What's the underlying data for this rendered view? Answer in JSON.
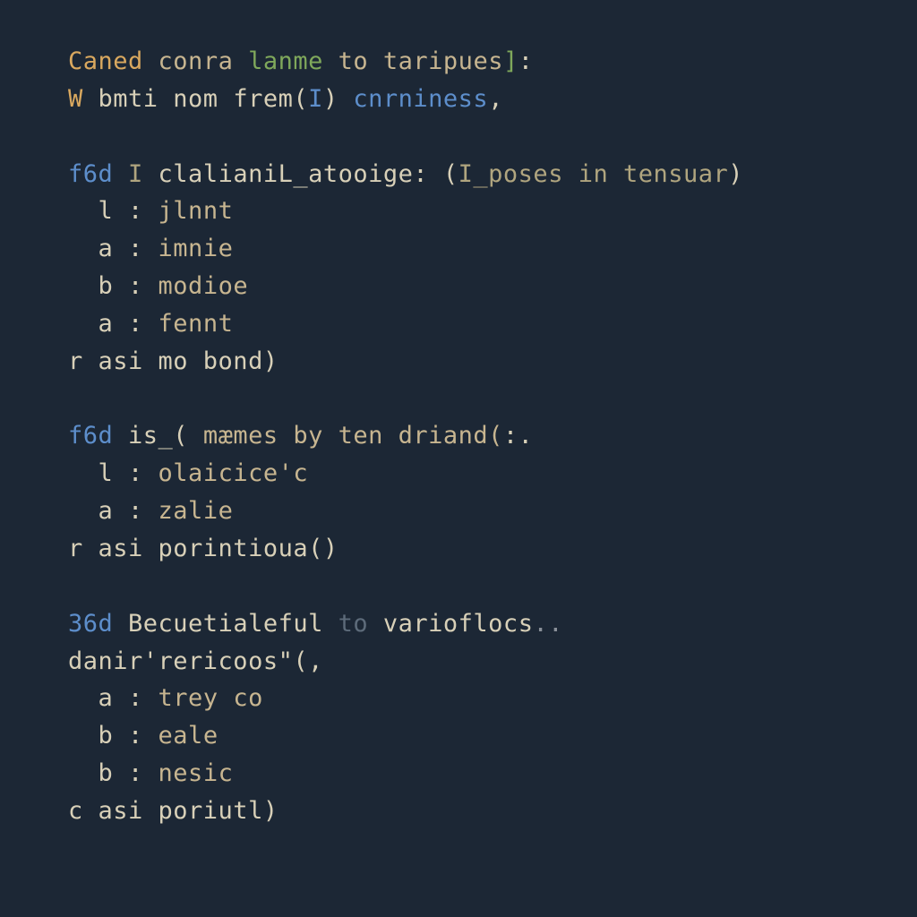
{
  "colors": {
    "bg": "#1c2735",
    "orange": "#d9a85f",
    "green": "#7fa85b",
    "blue": "#5d8ecb",
    "cream": "#d8d0b8",
    "gray": "#8a9099",
    "tan": "#c7b590",
    "grayblue": "#5d6b7a",
    "tan2": "#b0a57f"
  },
  "lines": [
    {
      "id": "l01",
      "tokens": [
        {
          "cls": "c-orange",
          "text": "Caned "
        },
        {
          "cls": "c-tan",
          "text": "conra "
        },
        {
          "cls": "c-green",
          "text": "lanme "
        },
        {
          "cls": "c-tan",
          "text": "to taripues"
        },
        {
          "cls": "c-green",
          "text": "]"
        },
        {
          "cls": "c-cream",
          "text": ":"
        }
      ]
    },
    {
      "id": "l02",
      "tokens": [
        {
          "cls": "c-orange",
          "text": "W "
        },
        {
          "cls": "c-cream",
          "text": "bmti nom frem("
        },
        {
          "cls": "c-blue",
          "text": "I"
        },
        {
          "cls": "c-cream",
          "text": ") "
        },
        {
          "cls": "c-blue",
          "text": "cnrniness"
        },
        {
          "cls": "c-cream",
          "text": ","
        }
      ]
    },
    {
      "id": "l03",
      "blank": true
    },
    {
      "id": "l04",
      "tokens": [
        {
          "cls": "c-bluekey",
          "text": "f6d "
        },
        {
          "cls": "c-tan2",
          "text": "I "
        },
        {
          "cls": "c-cream",
          "text": "clalianiL_atooige: ("
        },
        {
          "cls": "c-tan2",
          "text": "I_poses in tensuar"
        },
        {
          "cls": "c-cream",
          "text": ")"
        }
      ]
    },
    {
      "id": "l05",
      "tokens": [
        {
          "cls": "c-cream",
          "text": "  l : "
        },
        {
          "cls": "c-tan",
          "text": "jlnnt"
        }
      ]
    },
    {
      "id": "l06",
      "tokens": [
        {
          "cls": "c-cream",
          "text": "  a : "
        },
        {
          "cls": "c-tan",
          "text": "imnie"
        }
      ]
    },
    {
      "id": "l07",
      "tokens": [
        {
          "cls": "c-cream",
          "text": "  b : "
        },
        {
          "cls": "c-tan",
          "text": "modioe"
        }
      ]
    },
    {
      "id": "l08",
      "tokens": [
        {
          "cls": "c-cream",
          "text": "  a : "
        },
        {
          "cls": "c-tan",
          "text": "fennt"
        }
      ]
    },
    {
      "id": "l09",
      "tokens": [
        {
          "cls": "c-cream",
          "text": "r asi mo bond)"
        }
      ]
    },
    {
      "id": "l10",
      "blank": true
    },
    {
      "id": "l11",
      "tokens": [
        {
          "cls": "c-bluekey",
          "text": "f6d "
        },
        {
          "cls": "c-cream",
          "text": "is_( "
        },
        {
          "cls": "c-tan",
          "text": "mæmes by ten driand("
        },
        {
          "cls": "c-cream",
          "text": ":."
        }
      ]
    },
    {
      "id": "l12",
      "tokens": [
        {
          "cls": "c-cream",
          "text": "  l : "
        },
        {
          "cls": "c-tan",
          "text": "olaicice'c"
        }
      ]
    },
    {
      "id": "l13",
      "tokens": [
        {
          "cls": "c-cream",
          "text": "  a : "
        },
        {
          "cls": "c-tan",
          "text": "zalie"
        }
      ]
    },
    {
      "id": "l14",
      "tokens": [
        {
          "cls": "c-cream",
          "text": "r asi porintioua()"
        }
      ]
    },
    {
      "id": "l15",
      "blank": true
    },
    {
      "id": "l16",
      "tokens": [
        {
          "cls": "c-bluekey",
          "text": "36d "
        },
        {
          "cls": "c-cream",
          "text": "Becuetialeful "
        },
        {
          "cls": "c-grayblue",
          "text": "to "
        },
        {
          "cls": "c-cream",
          "text": "varioflocs"
        },
        {
          "cls": "c-gray",
          "text": ".."
        }
      ]
    },
    {
      "id": "l17",
      "tokens": [
        {
          "cls": "c-cream",
          "text": "danir'rericoos\"(,"
        }
      ]
    },
    {
      "id": "l18",
      "tokens": [
        {
          "cls": "c-cream",
          "text": "  a : "
        },
        {
          "cls": "c-tan",
          "text": "trey co"
        }
      ]
    },
    {
      "id": "l19",
      "tokens": [
        {
          "cls": "c-cream",
          "text": "  b : "
        },
        {
          "cls": "c-tan",
          "text": "eale"
        }
      ]
    },
    {
      "id": "l20",
      "tokens": [
        {
          "cls": "c-cream",
          "text": "  b : "
        },
        {
          "cls": "c-tan",
          "text": "nesic"
        }
      ]
    },
    {
      "id": "l21",
      "tokens": [
        {
          "cls": "c-cream",
          "text": "c asi poriutl)"
        }
      ]
    }
  ]
}
